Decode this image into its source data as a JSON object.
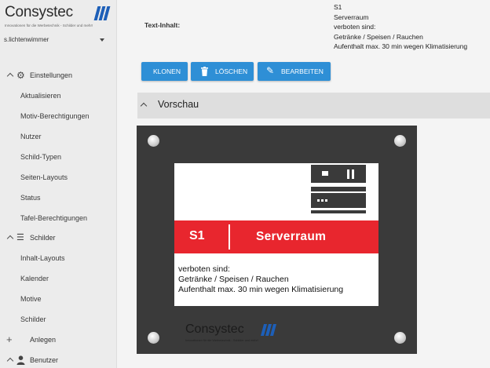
{
  "brand": {
    "name": "Consystec",
    "tagline": "Innovationen für die Werbetechnik - Schilder und mehr!",
    "accent": "#1d5fb8"
  },
  "user": {
    "name": "s.lichtenwimmer"
  },
  "sidebar": {
    "groups": [
      {
        "label": "Einstellungen",
        "icon": "gear-icon",
        "items": [
          "Aktualisieren",
          "Motiv-Berechtigungen",
          "Nutzer",
          "Schild-Typen",
          "Seiten-Layouts",
          "Status",
          "Tafel-Berechtigungen"
        ]
      },
      {
        "label": "Schilder",
        "icon": "list-icon",
        "items": [
          "Inhalt-Layouts",
          "Kalender",
          "Motive",
          "Schilder"
        ]
      },
      {
        "label": "Anlegen",
        "icon": "plus-icon",
        "items": []
      },
      {
        "label": "Benutzer",
        "icon": "person-icon",
        "items": []
      }
    ]
  },
  "detail": {
    "label": "Text-Inhalt:",
    "lines": [
      "S1",
      "Serverraum",
      "verboten sind:",
      "Getränke / Speisen / Rauchen",
      "Aufenthalt max. 30 min wegen Klimatisierung"
    ]
  },
  "actions": {
    "clone": "KLONEN",
    "delete": "LÖSCHEN",
    "edit": "BEARBEITEN",
    "color": "#2e8fd6"
  },
  "preview": {
    "title": "Vorschau",
    "sign": {
      "code": "S1",
      "name": "Serverraum",
      "band_color": "#e8262e",
      "lines": [
        "verboten sind:",
        "Getränke / Speisen / Rauchen",
        "Aufenthalt max. 30 min wegen Klimatisierung"
      ],
      "logo_name": "Consystec",
      "logo_tagline": "Innovationen für die Werbetechnik - Schilder und mehr!"
    }
  }
}
